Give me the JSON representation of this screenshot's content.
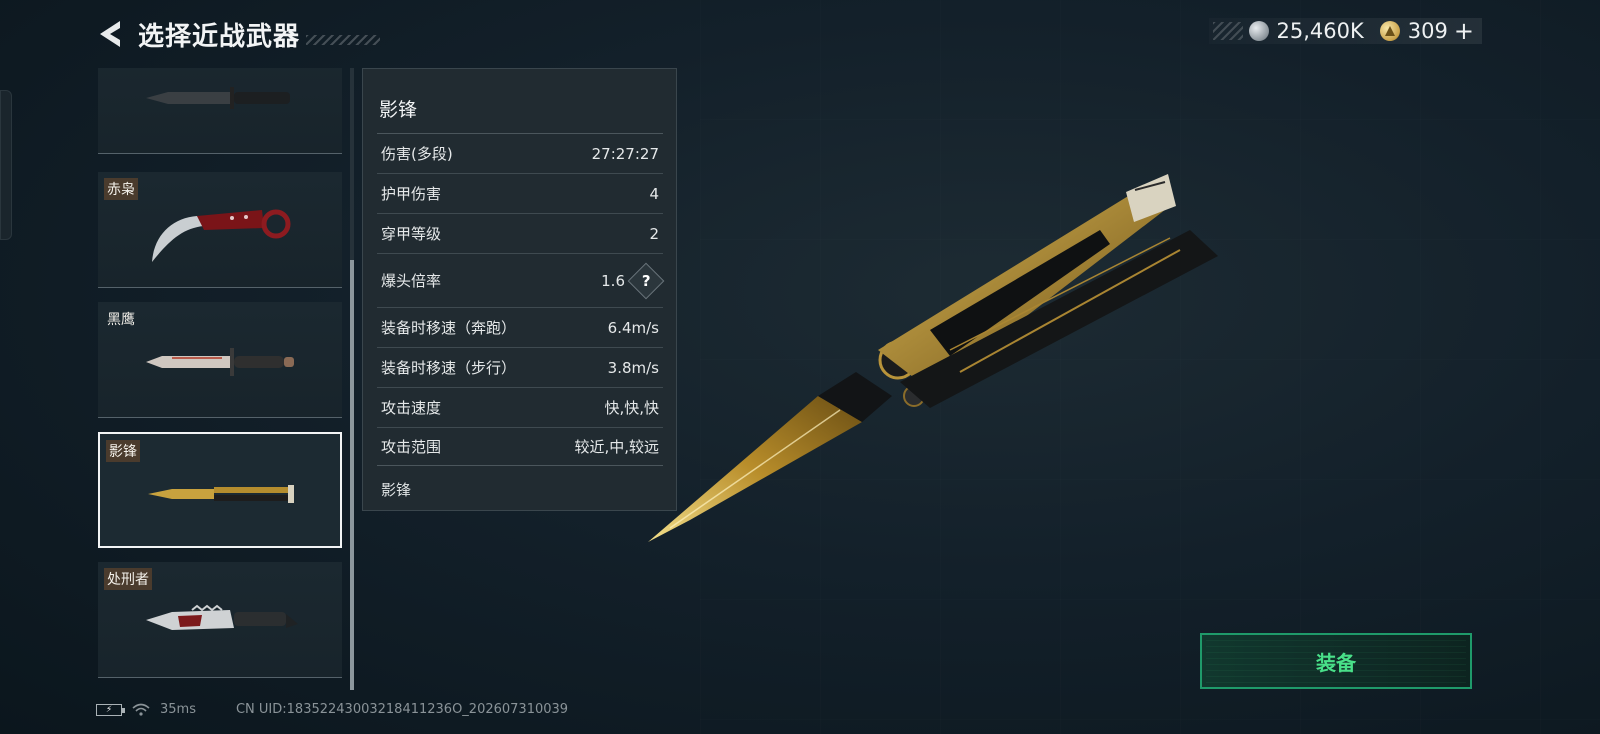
{
  "header": {
    "title": "选择近战武器",
    "currency": [
      {
        "icon": "silver-coin-icon",
        "value": "25,460K"
      },
      {
        "icon": "gold-coin-icon",
        "value": "309"
      }
    ],
    "add_label": "+"
  },
  "weapon_list": [
    {
      "name": "",
      "selected": false
    },
    {
      "name": "赤枭",
      "selected": false
    },
    {
      "name": "黑鹰",
      "selected": false
    },
    {
      "name": "影锋",
      "selected": true
    },
    {
      "name": "处刑者",
      "selected": false
    }
  ],
  "stats": {
    "weapon_name": "影锋",
    "rows": [
      {
        "label": "伤害(多段)",
        "value": "27:27:27"
      },
      {
        "label": "护甲伤害",
        "value": "4"
      },
      {
        "label": "穿甲等级",
        "value": "2"
      },
      {
        "label": "爆头倍率",
        "value": "1.6",
        "help": "?"
      },
      {
        "label": "装备时移速（奔跑）",
        "value": "6.4m/s"
      },
      {
        "label": "装备时移速（步行）",
        "value": "3.8m/s"
      },
      {
        "label": "攻击速度",
        "value": "快,快,快"
      },
      {
        "label": "攻击范围",
        "value": "较近,中,较远"
      }
    ],
    "description": "影锋"
  },
  "equip_label": "装备",
  "footer": {
    "battery_icon": "battery-charging-icon",
    "wifi_icon": "wifi-icon",
    "ping": "35ms",
    "uid": "CN UID:18352243003218411236O_202607310039"
  },
  "colors": {
    "accent_green": "#49e089",
    "equip_border": "#1f9a6a",
    "label_bg": "#4a3b2d"
  }
}
